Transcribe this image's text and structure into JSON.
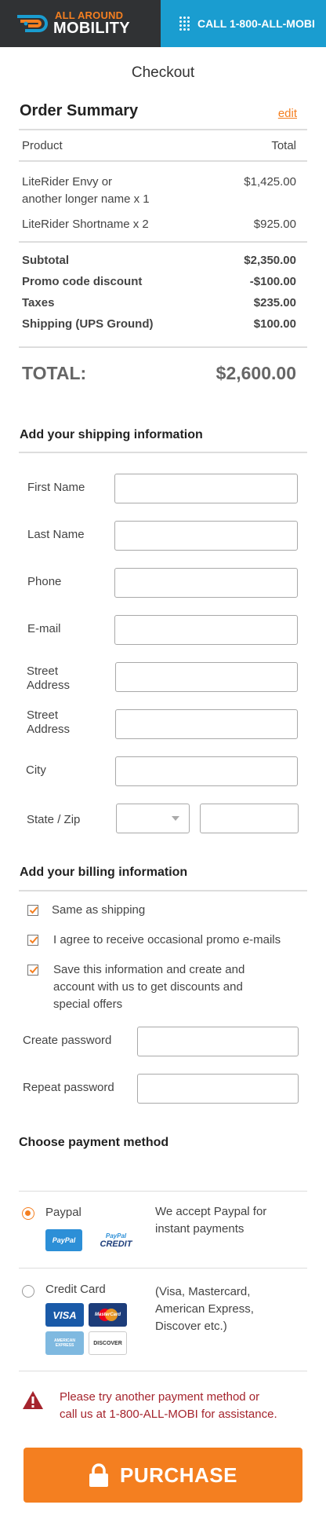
{
  "header": {
    "brand_top": "ALL AROUND",
    "brand_bottom": "MOBILITY",
    "call_label": "CALL 1-800-ALL-MOBI",
    "colors": {
      "dark": "#303234",
      "accent": "#f47f20",
      "blue": "#1a9dd0"
    }
  },
  "page_title": "Checkout",
  "order_summary": {
    "title": "Order Summary",
    "edit_label": "edit",
    "col_product": "Product",
    "col_total": "Total",
    "items": [
      {
        "name_line1": "LiteRider Envy or",
        "name_line2": "another longer name x 1",
        "price": "$1,425.00"
      },
      {
        "name_line1": "LiteRider Shortname x 2",
        "price": "$925.00"
      }
    ],
    "subtotal_label": "Subtotal",
    "subtotal_value": "$2,350.00",
    "promo_label": "Promo code discount",
    "promo_value": "-$100.00",
    "taxes_label": "Taxes",
    "taxes_value": "$235.00",
    "shipping_label": "Shipping (UPS Ground)",
    "shipping_value": "$100.00",
    "total_label": "TOTAL:",
    "total_value": "$2,600.00"
  },
  "shipping": {
    "title": "Add your shipping information",
    "first_name": "First Name",
    "last_name": "Last Name",
    "phone": "Phone",
    "email": "E-mail",
    "street1_a": "Street",
    "street1_b": "Address",
    "street2_a": "Street",
    "street2_b": "Address",
    "city": "City",
    "state_zip": "State / Zip"
  },
  "billing": {
    "title": "Add your billing information",
    "same_as_shipping": "Same as shipping",
    "promo_emails": "I agree to receive occasional promo e-mails",
    "save_line1": "Save this information and create and",
    "save_line2": "account with us to get discounts and",
    "save_line3": "special offers",
    "create_password": "Create password",
    "repeat_password": "Repeat password"
  },
  "payment": {
    "title": "Choose payment method",
    "paypal_label": "Paypal",
    "paypal_desc_1": "We accept Paypal for",
    "paypal_desc_2": "instant payments",
    "paypal_logo": "PayPal",
    "paypal_credit_top": "PayPal",
    "paypal_credit_bottom": "CREDIT",
    "card_label": "Credit Card",
    "card_desc_1": "(Visa, Mastercard,",
    "card_desc_2": "American Express,",
    "card_desc_3": "Discover etc.)",
    "visa": "VISA",
    "mastercard": "MasterCard",
    "amex": "AMERICAN EXPRESS",
    "discover": "DISCOVER",
    "selected": "Paypal"
  },
  "warning": {
    "line1": "Please try another payment method or",
    "line2": "call us at 1-800-ALL-MOBI for assistance."
  },
  "purchase_label": "PURCHASE"
}
